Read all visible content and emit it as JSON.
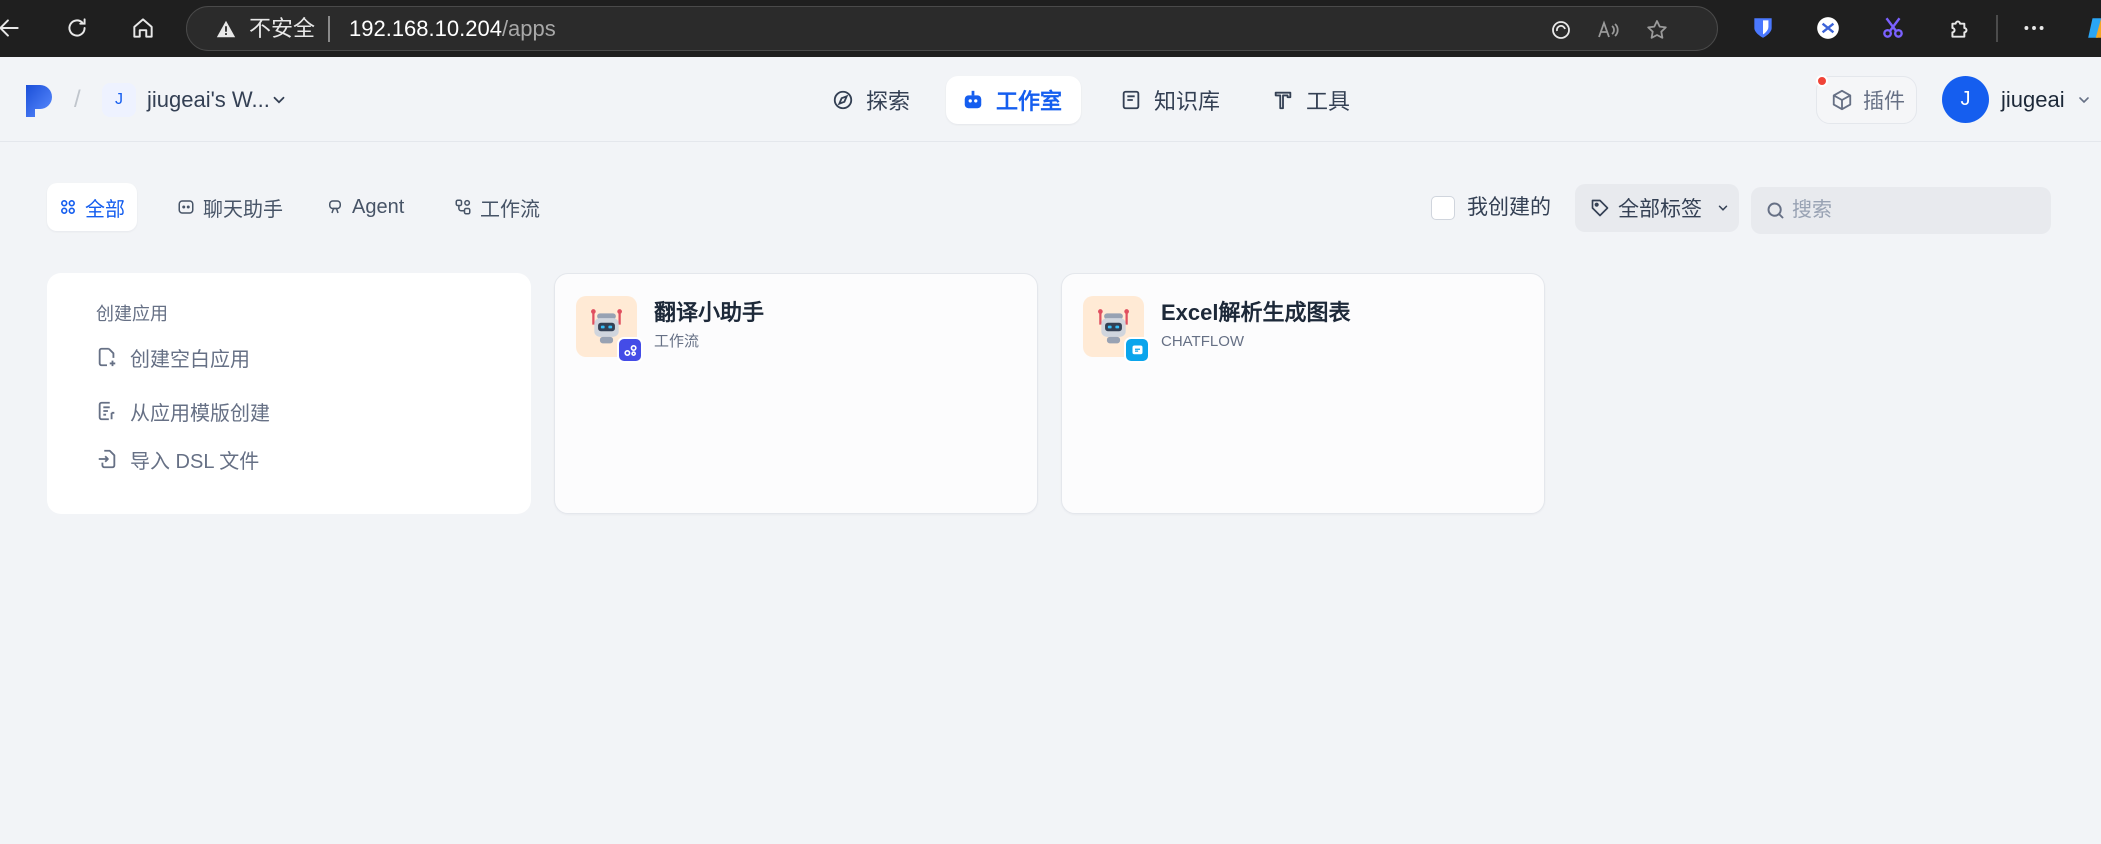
{
  "browser": {
    "security_label": "不安全",
    "url_host": "192.168.10.204",
    "url_path": "/apps"
  },
  "workspace": {
    "avatar_letter": "J",
    "name": "jiugeai's W..."
  },
  "nav": {
    "explore": "探索",
    "studio": "工作室",
    "knowledge": "知识库",
    "tools": "工具"
  },
  "plugins_label": "插件",
  "user": {
    "avatar_letter": "J",
    "name": "jiugeai"
  },
  "filters": {
    "all": "全部",
    "chat": "聊天助手",
    "agent": "Agent",
    "workflow": "工作流",
    "created_by_me": "我创建的",
    "all_tags": "全部标签",
    "search_placeholder": "搜索"
  },
  "create_card": {
    "title": "创建应用",
    "blank": "创建空白应用",
    "from_template": "从应用模版创建",
    "import_dsl": "导入 DSL 文件"
  },
  "apps": [
    {
      "name": "翻译小助手",
      "type": "工作流",
      "badge_color": "#444ce7"
    },
    {
      "name": "Excel解析生成图表",
      "type": "CHATFLOW",
      "badge_color": "#0ba5ec"
    }
  ],
  "colors": {
    "accent": "#155eef",
    "page_bg": "#f2f4f7",
    "browser_chrome": "#1f1f1f"
  }
}
